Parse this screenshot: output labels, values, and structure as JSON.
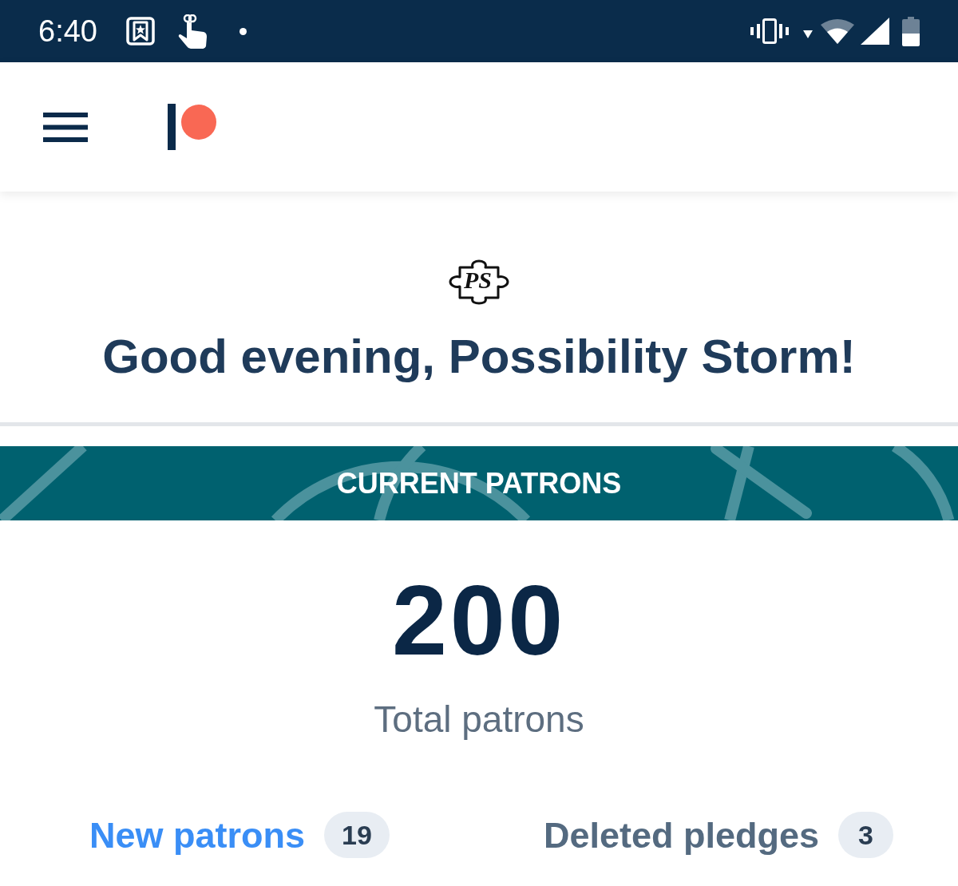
{
  "status_bar": {
    "time": "6:40"
  },
  "avatar": {
    "initials": "PS"
  },
  "greeting": "Good evening, Possibility Storm!",
  "banner": {
    "title": "CURRENT PATRONS"
  },
  "summary": {
    "value": "200",
    "label": "Total patrons"
  },
  "tabs": [
    {
      "label": "New patrons",
      "count": "19",
      "selected": true
    },
    {
      "label": "Deleted pledges",
      "count": "3",
      "selected": false
    }
  ]
}
